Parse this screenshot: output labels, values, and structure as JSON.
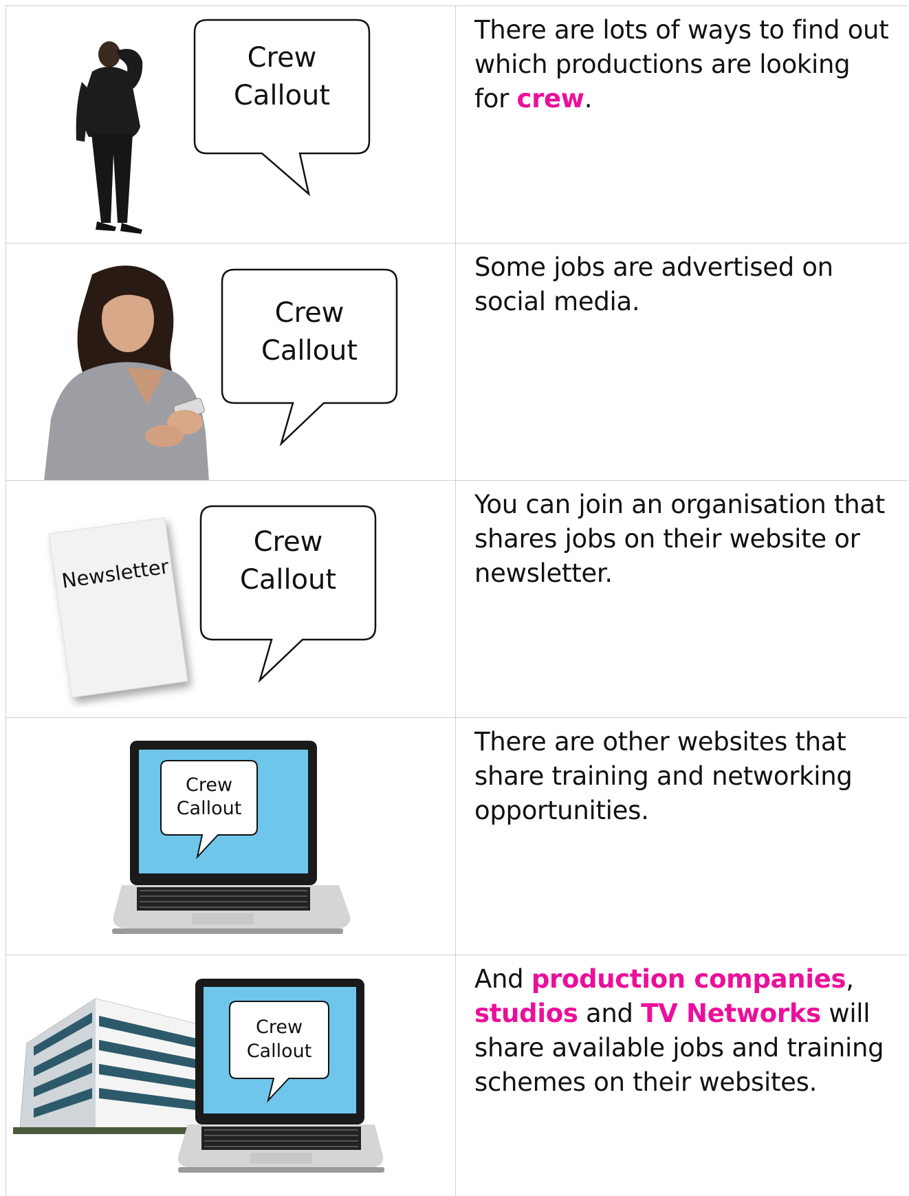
{
  "rows": [
    {
      "bubble": {
        "line1": "Crew",
        "line2": "Callout"
      },
      "text": {
        "part1": "There are lots of ways to find out which productions are looking for ",
        "highlight1": "crew",
        "part2": "."
      }
    },
    {
      "bubble": {
        "line1": "Crew",
        "line2": "Callout"
      },
      "text": {
        "part1": "Some jobs are advertised on social media."
      }
    },
    {
      "newsletter_label": "Newsletter",
      "bubble": {
        "line1": "Crew",
        "line2": "Callout"
      },
      "text": {
        "part1": "You can join an organisation that shares jobs on their website or newsletter."
      }
    },
    {
      "bubble": {
        "line1": "Crew",
        "line2": "Callout"
      },
      "text": {
        "part1": "There are other websites that share training and networking opportunities."
      }
    },
    {
      "bubble": {
        "line1": "Crew",
        "line2": "Callout"
      },
      "text": {
        "part0": "And ",
        "highlight1": "production companies",
        "part1": ", ",
        "highlight2": "studios",
        "part2": " and ",
        "highlight3": "TV Networks",
        "part3": " will share available jobs and training schemes on their websites."
      }
    }
  ],
  "colors": {
    "highlight": "#ec0f9b",
    "screen": "#6ec6ea"
  }
}
